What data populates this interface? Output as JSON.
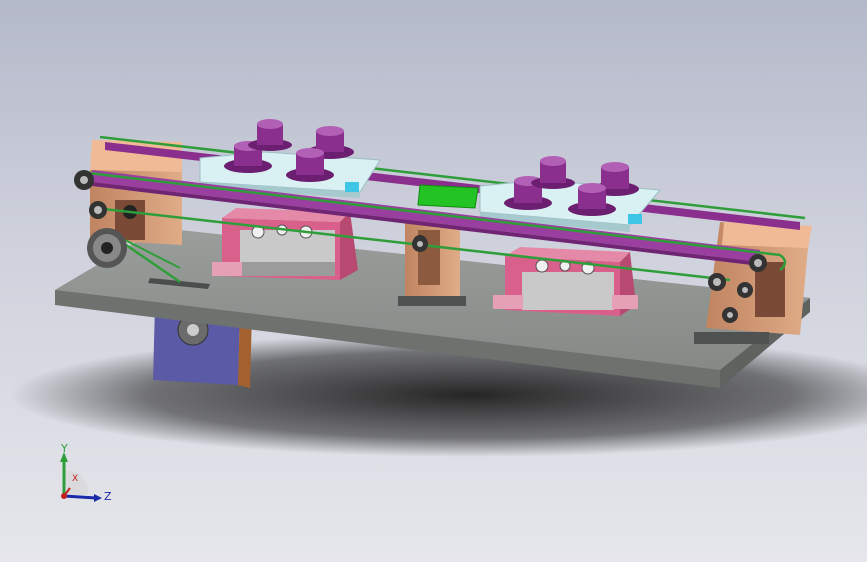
{
  "viewport": {
    "background_top": "#b4b9ca",
    "background_bottom": "#e6e7ec"
  },
  "model": {
    "colors": {
      "base_plate": "#8f9390",
      "frame": "#d9a07b",
      "rail_purple": "#9a3fa0",
      "belt_green": "#2f9e3a",
      "fixture_purple": "#8a2f8e",
      "carrier_plate": "#d9f1f3",
      "cylinder_block": "#d9608a",
      "motor": "#5b5aa6",
      "green_pad": "#22c322",
      "cyan_block": "#3fc5e6"
    }
  },
  "triad": {
    "y_label": "Y",
    "x_label": "X",
    "z_label": "Z"
  }
}
